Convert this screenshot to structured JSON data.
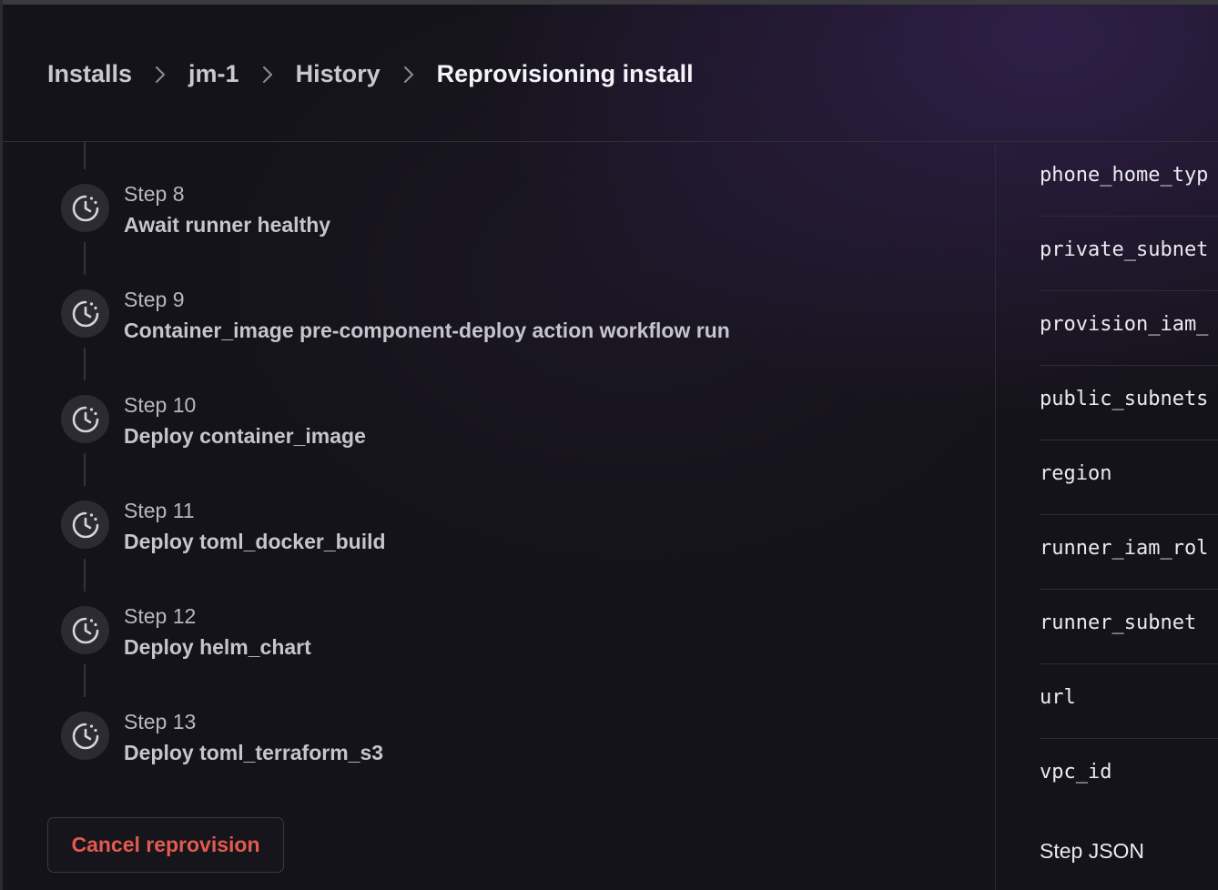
{
  "breadcrumb": {
    "items": [
      "Installs",
      "jm-1",
      "History"
    ],
    "current": "Reprovisioning install"
  },
  "steps": [
    {
      "number": "Step 8",
      "title": "Await runner healthy",
      "icon": "clock-pending-icon"
    },
    {
      "number": "Step 9",
      "title": "Container_image pre-component-deploy action workflow run",
      "icon": "clock-pending-icon"
    },
    {
      "number": "Step 10",
      "title": "Deploy container_image",
      "icon": "clock-pending-icon"
    },
    {
      "number": "Step 11",
      "title": "Deploy toml_docker_build",
      "icon": "clock-pending-icon"
    },
    {
      "number": "Step 12",
      "title": "Deploy helm_chart",
      "icon": "clock-pending-icon"
    },
    {
      "number": "Step 13",
      "title": "Deploy toml_terraform_s3",
      "icon": "clock-pending-icon"
    }
  ],
  "cancel_button": {
    "label": "Cancel reprovision",
    "color": "#e35a4e"
  },
  "side_panel": {
    "keys": [
      "phone_home_typ",
      "private_subnet",
      "provision_iam_",
      "public_subnets",
      "region",
      "runner_iam_rol",
      "runner_subnet",
      "url",
      "vpc_id"
    ],
    "step_json_label": "Step JSON"
  }
}
